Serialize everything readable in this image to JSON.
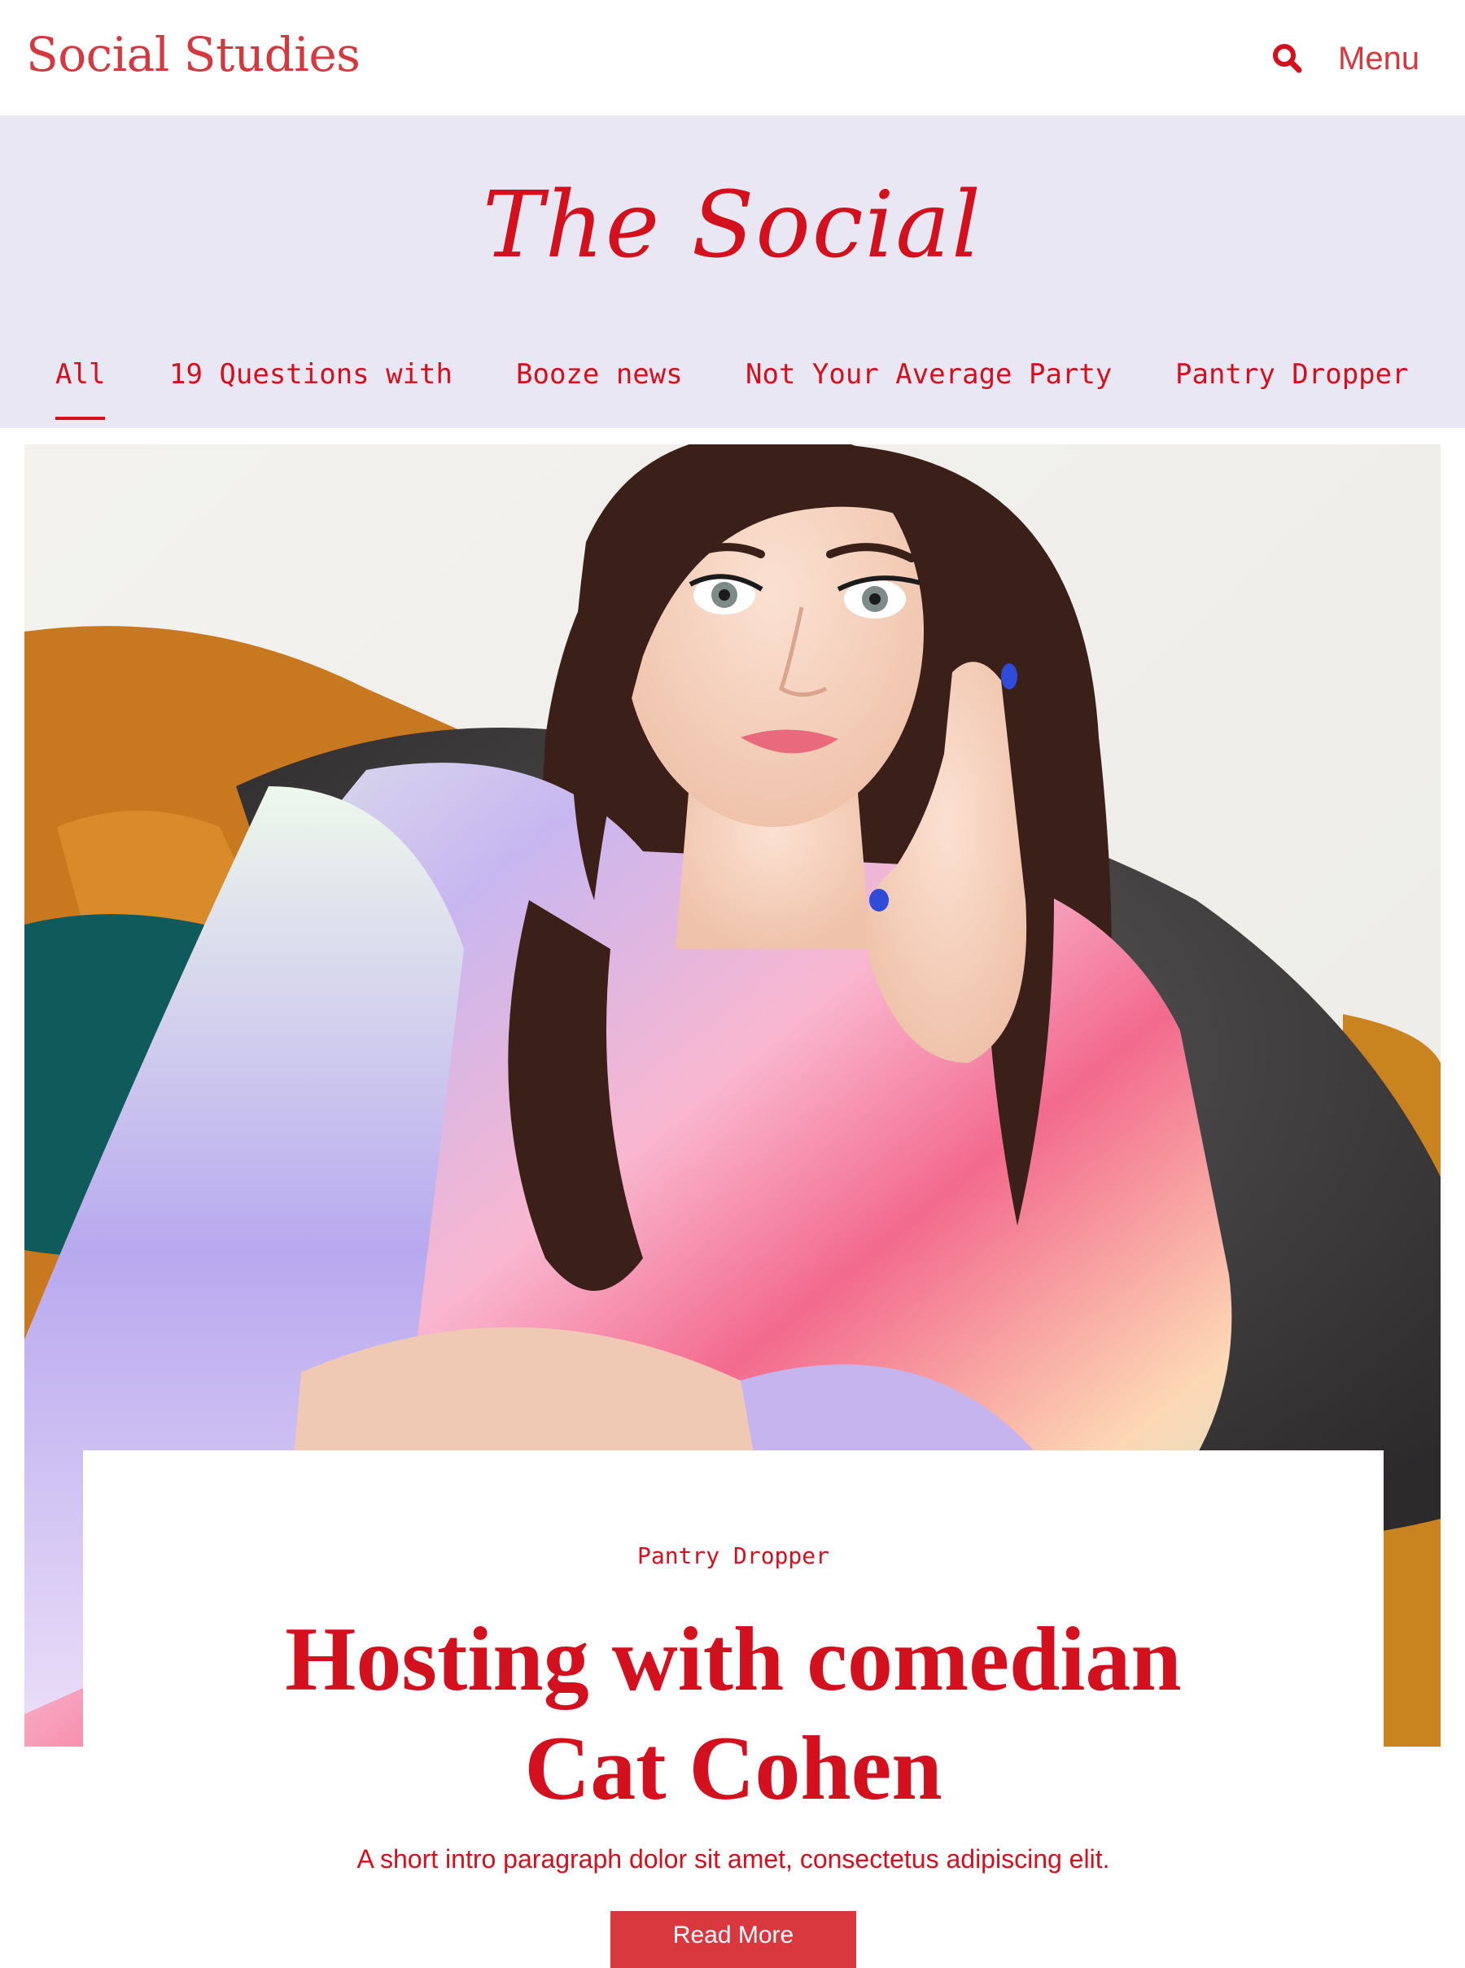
{
  "header": {
    "brand": "Social Studies",
    "search_icon": "search-icon",
    "menu_label": "Menu"
  },
  "hero": {
    "script_title": "The Social"
  },
  "tabs": [
    {
      "label": "All",
      "active": true
    },
    {
      "label": "19 Questions with",
      "active": false
    },
    {
      "label": "Booze news",
      "active": false
    },
    {
      "label": "Not Your Average Party",
      "active": false
    },
    {
      "label": "Pantry Dropper",
      "active": false
    }
  ],
  "feature": {
    "category": "Pantry Dropper",
    "title_line1": "Hosting with comedian",
    "title_line2": "Cat Cohen",
    "intro": "A short intro paragraph dolor sit amet, consectetus adipiscing elit.",
    "button_label": "Read More"
  },
  "colors": {
    "accent": "#d2101e",
    "brand": "#d23a3f",
    "band_background": "#e9e7f3",
    "button": "#d9383f"
  }
}
